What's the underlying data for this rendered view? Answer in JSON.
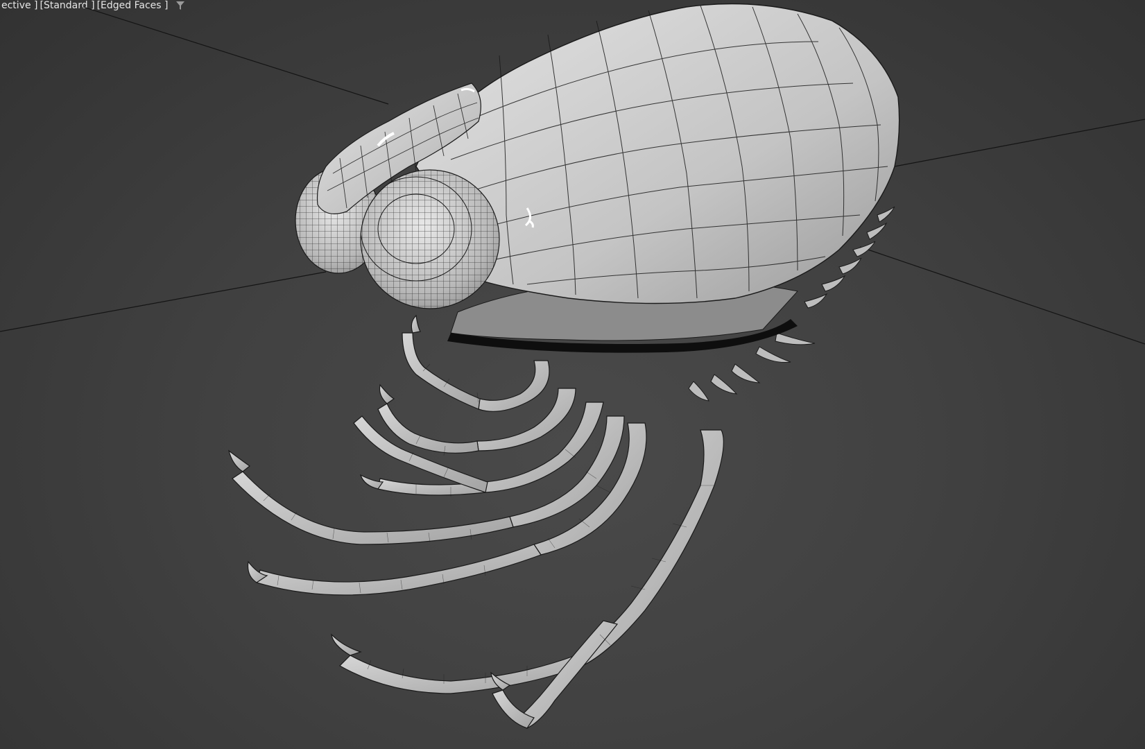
{
  "viewport": {
    "label_view": "ective ]",
    "label_shading": "[Standard ]",
    "label_style": "[Edged Faces ]",
    "filter_icon": "filter-icon",
    "background_color": "#414141",
    "grid_line_color": "#141414",
    "mesh_color": "#c9c9c9",
    "wire_color": "#1a1a1a"
  },
  "scene": {
    "object": "creature-mesh",
    "parts": [
      "body-shell",
      "eye-left",
      "eye-right",
      "antenna",
      "legs"
    ]
  }
}
